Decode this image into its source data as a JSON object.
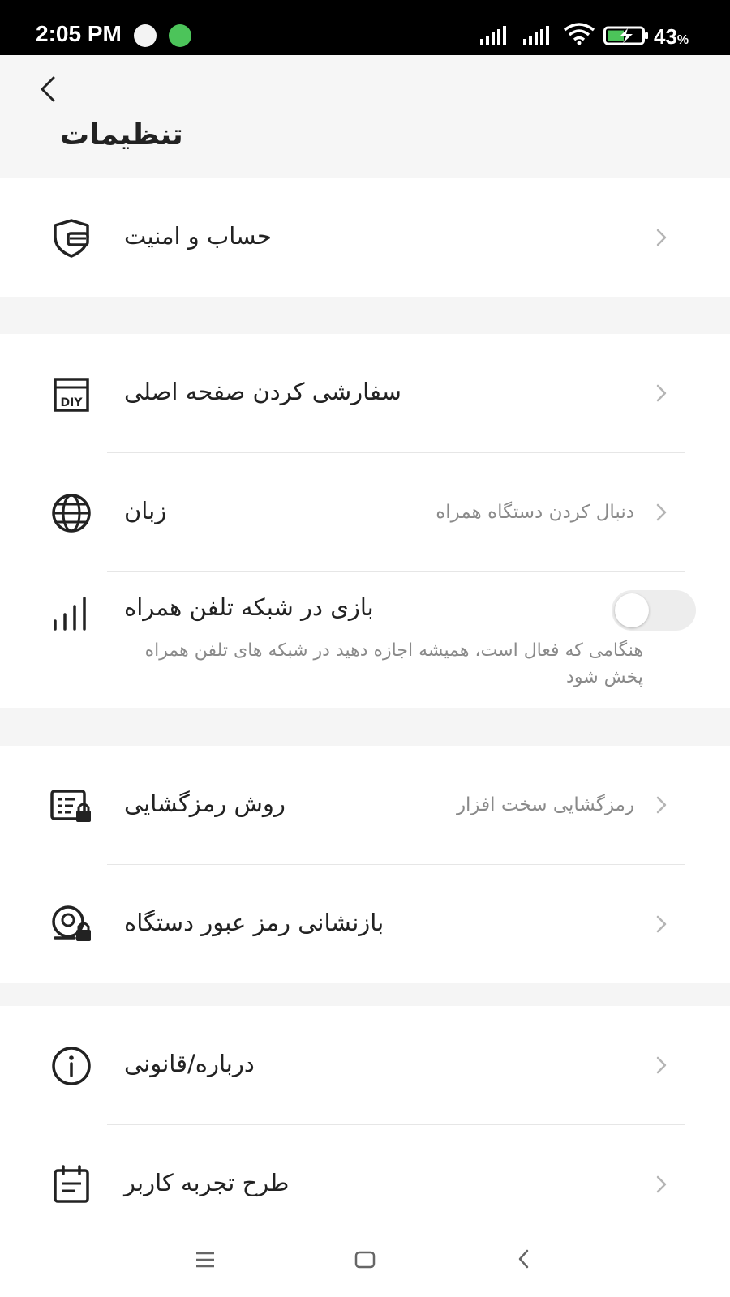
{
  "status_bar": {
    "time": "2:05 PM",
    "battery_percent": "43",
    "battery_unit": "%",
    "icons": [
      "app-notification-icon",
      "app-notification-icon",
      "signal-icon",
      "signal-icon",
      "wifi-icon",
      "battery-charging-icon"
    ]
  },
  "header": {
    "title": "تنظیمات",
    "back_icon": "chevron-left-icon"
  },
  "sections": [
    {
      "items": [
        {
          "label": "حساب و امنیت",
          "icon": "shield-card-icon"
        }
      ]
    },
    {
      "items": [
        {
          "label": "سفارشی کردن صفحه اصلی",
          "icon": "diy-icon"
        },
        {
          "label": "زبان",
          "value": "دنبال کردن دستگاه همراه",
          "icon": "globe-icon"
        },
        {
          "label": "بازی در شبکه تلفن همراه",
          "description": "هنگامی که فعال است، همیشه اجازه دهید در شبکه های تلفن همراه پخش شود",
          "icon": "signal-bars-icon",
          "toggle_on": false
        }
      ]
    },
    {
      "items": [
        {
          "label": "روش رمزگشایی",
          "value": "رمزگشایی سخت افزار",
          "icon": "decode-lock-icon"
        },
        {
          "label": "بازنشانی رمز عبور دستگاه",
          "icon": "camera-lock-icon"
        }
      ]
    },
    {
      "items": [
        {
          "label": "درباره/قانونی",
          "icon": "info-icon"
        },
        {
          "label": "طرح تجربه کاربر",
          "icon": "calendar-note-icon"
        }
      ]
    }
  ],
  "colors": {
    "status_bar_bg": "#000000",
    "header_bg": "#f6f6f6",
    "section_gap_bg": "#f5f5f5",
    "primary_text": "#222222",
    "secondary_text": "#8a8a8a",
    "toggle_off_track": "#ededed"
  },
  "nav_bar": {
    "icons": [
      "menu-icon",
      "home-icon",
      "back-icon"
    ]
  }
}
